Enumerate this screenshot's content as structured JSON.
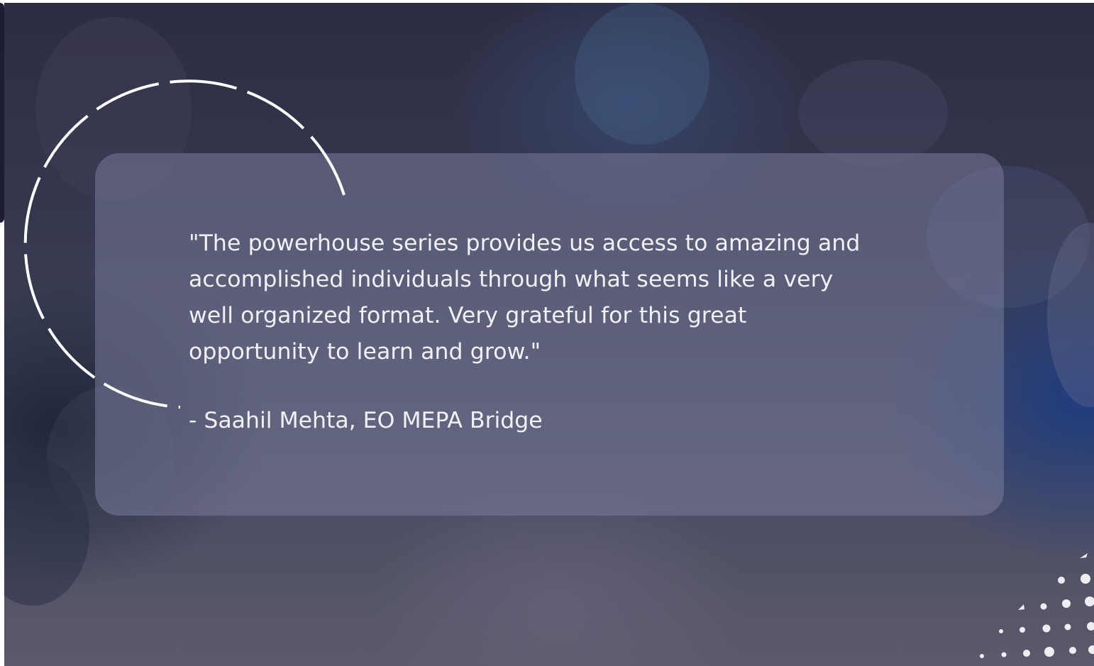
{
  "testimonial": {
    "quote": "\"The powerhouse series provides us access to amazing and accomplished individuals through what seems like a very well organized format. Very grateful for this great opportunity to learn and grow.\"",
    "attribution": "- Saahil Mehta, EO MEPA Bridge"
  },
  "colors": {
    "text": "#f1f1f7",
    "card": "#7c7e9e",
    "background_dark": "#2c2d43",
    "decor": "#ffffff"
  },
  "icons": {
    "quote_decoration": "dashed-arc-icon",
    "corner_decoration": "dot-pattern-icon"
  }
}
